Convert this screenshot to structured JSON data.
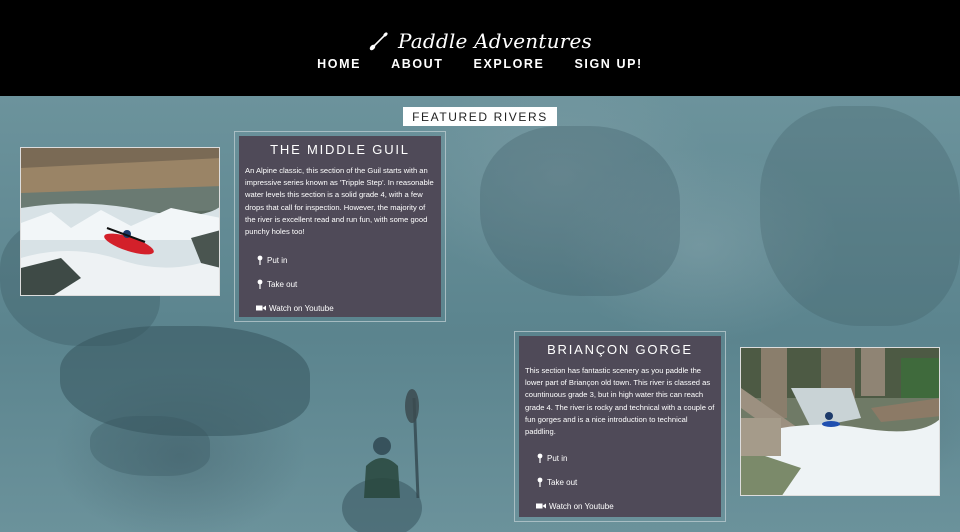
{
  "brand": {
    "name": "Paddle Adventures",
    "icon": "paddle-icon"
  },
  "nav": {
    "items": [
      "HOME",
      "ABOUT",
      "EXPLORE",
      "SIGN UP!"
    ]
  },
  "featured_label": "FEATURED RIVERS",
  "rivers": [
    {
      "title": "THE MIDDLE GUIL",
      "description": "An Alpine classic, this section of the Guil starts with an impressive series known as 'Tripple Step'. In reasonable water levels this section is a solid grade 4, with a few drops that call for inspection. However, the majority of the river is excellent read and run fun, with some good punchy holes too!",
      "links": [
        {
          "label": "Put in",
          "icon": "map-pin-icon"
        },
        {
          "label": "Take out",
          "icon": "map-pin-icon"
        },
        {
          "label": "Watch on Youtube",
          "icon": "video-camera-icon"
        }
      ]
    },
    {
      "title": "BRIANÇON GORGE",
      "description": "This section has fantastic scenery as you paddle the lower part of Briançon old town. This river is classed as countinuous grade 3, but in high water this can reach grade 4. The river is rocky and technical with a couple of fun gorges and is a nice introduction to technical paddling.",
      "links": [
        {
          "label": "Put in",
          "icon": "map-pin-icon"
        },
        {
          "label": "Take out",
          "icon": "map-pin-icon"
        },
        {
          "label": "Watch on Youtube",
          "icon": "video-camera-icon"
        }
      ]
    }
  ],
  "colors": {
    "header": "#000000",
    "card": "#4f4a58",
    "overlay": "#5f8791"
  }
}
